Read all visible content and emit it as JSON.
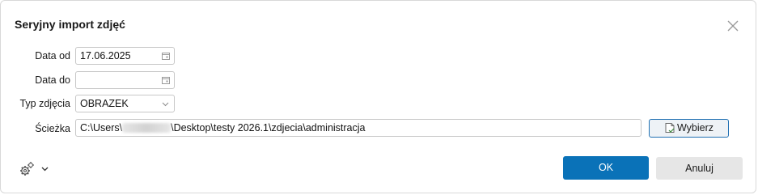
{
  "dialog": {
    "title": "Seryjny import zdjęć"
  },
  "form": {
    "date_from": {
      "label": "Data od",
      "value": "17.06.2025"
    },
    "date_to": {
      "label": "Data do",
      "value": ""
    },
    "photo_type": {
      "label": "Typ zdjęcia",
      "value": "OBRAZEK"
    },
    "path": {
      "label": "Ścieżka",
      "value_prefix": "C:\\Users\\",
      "value_suffix": "\\Desktop\\testy 2026.1\\zdjecia\\administracja",
      "browse_label": "Wybierz"
    }
  },
  "footer": {
    "ok_label": "OK",
    "cancel_label": "Anuluj"
  },
  "icons": {
    "close": "close-icon",
    "calendar": "calendar-icon",
    "dropdown": "chevron-down-icon",
    "browse": "folder-icon",
    "settings": "gears-icon"
  },
  "colors": {
    "primary_button": "#0a72b8",
    "secondary_button": "#e6e6e6",
    "focus_border": "#1f6fb2"
  }
}
